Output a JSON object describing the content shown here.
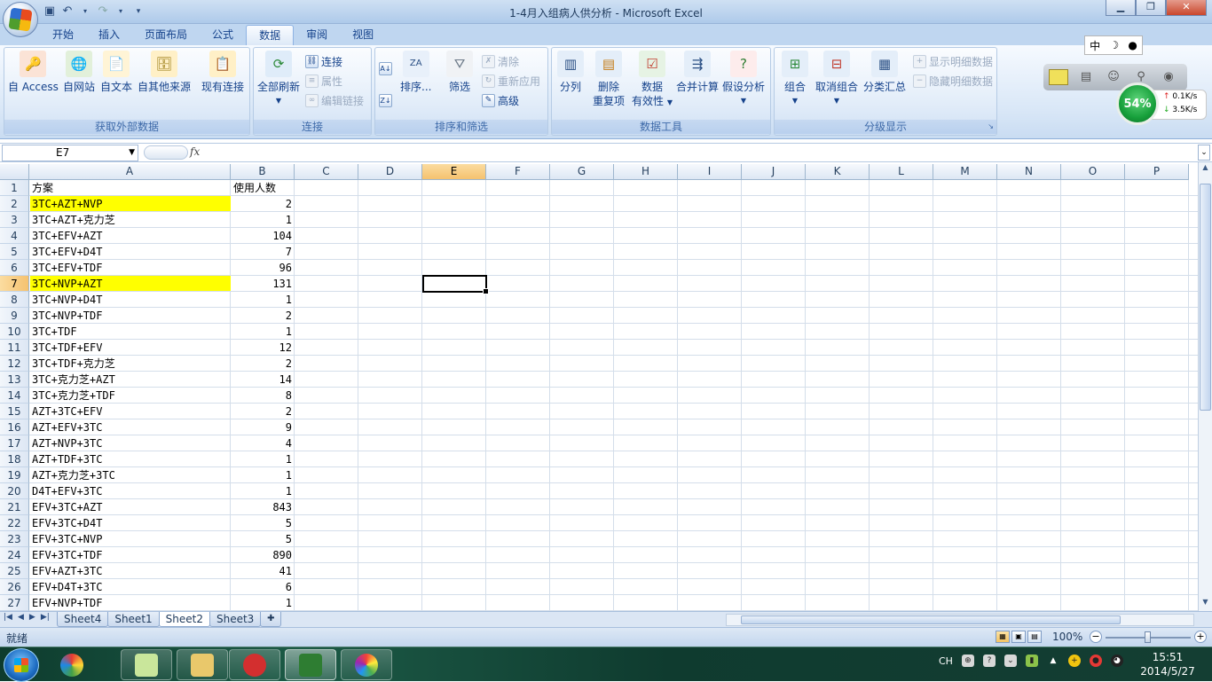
{
  "window": {
    "title": "1-4月入组病人供分析 - Microsoft Excel",
    "controls": [
      "minimize",
      "restore",
      "close"
    ]
  },
  "ribbon_tabs": [
    "开始",
    "插入",
    "页面布局",
    "公式",
    "数据",
    "审阅",
    "视图"
  ],
  "active_tab": "数据",
  "ribbon": {
    "external_data": {
      "label": "获取外部数据",
      "access": "自 Access",
      "web": "自网站",
      "text": "自文本",
      "other": "自其他来源",
      "existing": "现有连接"
    },
    "connections": {
      "label": "连接",
      "refresh_all": "全部刷新",
      "connections": "连接",
      "properties": "属性",
      "edit_links": "编辑链接"
    },
    "sort_filter": {
      "label": "排序和筛选",
      "sort": "排序...",
      "filter": "筛选",
      "clear": "清除",
      "reapply": "重新应用",
      "advanced": "高级"
    },
    "data_tools": {
      "label": "数据工具",
      "text_to_columns": "分列",
      "remove_dup_1": "删除",
      "remove_dup_2": "重复项",
      "validation_1": "数据",
      "validation_2": "有效性",
      "consolidate": "合并计算",
      "whatif": "假设分析"
    },
    "outline": {
      "label": "分级显示",
      "group": "组合",
      "ungroup": "取消组合",
      "subtotal": "分类汇总",
      "show_detail": "显示明细数据",
      "hide_detail": "隐藏明细数据"
    }
  },
  "ime": {
    "lang": "中"
  },
  "net_widget": {
    "percent": "54%",
    "up": "0.1K/s",
    "down": "3.5K/s"
  },
  "name_box": "E7",
  "formula_value": "",
  "columns": [
    "A",
    "B",
    "C",
    "D",
    "E",
    "F",
    "G",
    "H",
    "I",
    "J",
    "K",
    "L",
    "M",
    "N",
    "O",
    "P"
  ],
  "selected_column": "E",
  "selected_row": "7",
  "rows": [
    {
      "n": "1",
      "a": "方案",
      "b": "使用人数",
      "hl": false
    },
    {
      "n": "2",
      "a": "3TC+AZT+NVP",
      "b": "2",
      "hl": true
    },
    {
      "n": "3",
      "a": "3TC+AZT+克力芝",
      "b": "1",
      "hl": false
    },
    {
      "n": "4",
      "a": "3TC+EFV+AZT",
      "b": "104",
      "hl": false
    },
    {
      "n": "5",
      "a": "3TC+EFV+D4T",
      "b": "7",
      "hl": false
    },
    {
      "n": "6",
      "a": "3TC+EFV+TDF",
      "b": "96",
      "hl": false
    },
    {
      "n": "7",
      "a": "3TC+NVP+AZT",
      "b": "131",
      "hl": true
    },
    {
      "n": "8",
      "a": "3TC+NVP+D4T",
      "b": "1",
      "hl": false
    },
    {
      "n": "9",
      "a": "3TC+NVP+TDF",
      "b": "2",
      "hl": false
    },
    {
      "n": "10",
      "a": "3TC+TDF",
      "b": "1",
      "hl": false
    },
    {
      "n": "11",
      "a": "3TC+TDF+EFV",
      "b": "12",
      "hl": false
    },
    {
      "n": "12",
      "a": "3TC+TDF+克力芝",
      "b": "2",
      "hl": false
    },
    {
      "n": "13",
      "a": "3TC+克力芝+AZT",
      "b": "14",
      "hl": false
    },
    {
      "n": "14",
      "a": "3TC+克力芝+TDF",
      "b": "8",
      "hl": false
    },
    {
      "n": "15",
      "a": "AZT+3TC+EFV",
      "b": "2",
      "hl": false
    },
    {
      "n": "16",
      "a": "AZT+EFV+3TC",
      "b": "9",
      "hl": false
    },
    {
      "n": "17",
      "a": "AZT+NVP+3TC",
      "b": "4",
      "hl": false
    },
    {
      "n": "18",
      "a": "AZT+TDF+3TC",
      "b": "1",
      "hl": false
    },
    {
      "n": "19",
      "a": "AZT+克力芝+3TC",
      "b": "1",
      "hl": false
    },
    {
      "n": "20",
      "a": "D4T+EFV+3TC",
      "b": "1",
      "hl": false
    },
    {
      "n": "21",
      "a": "EFV+3TC+AZT",
      "b": "843",
      "hl": false
    },
    {
      "n": "22",
      "a": "EFV+3TC+D4T",
      "b": "5",
      "hl": false
    },
    {
      "n": "23",
      "a": "EFV+3TC+NVP",
      "b": "5",
      "hl": false
    },
    {
      "n": "24",
      "a": "EFV+3TC+TDF",
      "b": "890",
      "hl": false
    },
    {
      "n": "25",
      "a": "EFV+AZT+3TC",
      "b": "41",
      "hl": false
    },
    {
      "n": "26",
      "a": "EFV+D4T+3TC",
      "b": "6",
      "hl": false
    },
    {
      "n": "27",
      "a": "EFV+NVP+TDF",
      "b": "1",
      "hl": false
    }
  ],
  "sheets": [
    "Sheet4",
    "Sheet1",
    "Sheet2",
    "Sheet3"
  ],
  "active_sheet": "Sheet2",
  "status": {
    "ready": "就绪",
    "zoom": "100%"
  },
  "clock": {
    "time": "15:51",
    "date": "2014/5/27"
  },
  "tray": {
    "lang": "CH"
  },
  "colors": {
    "highlight": "#ffff00",
    "accent": "#15428b"
  }
}
